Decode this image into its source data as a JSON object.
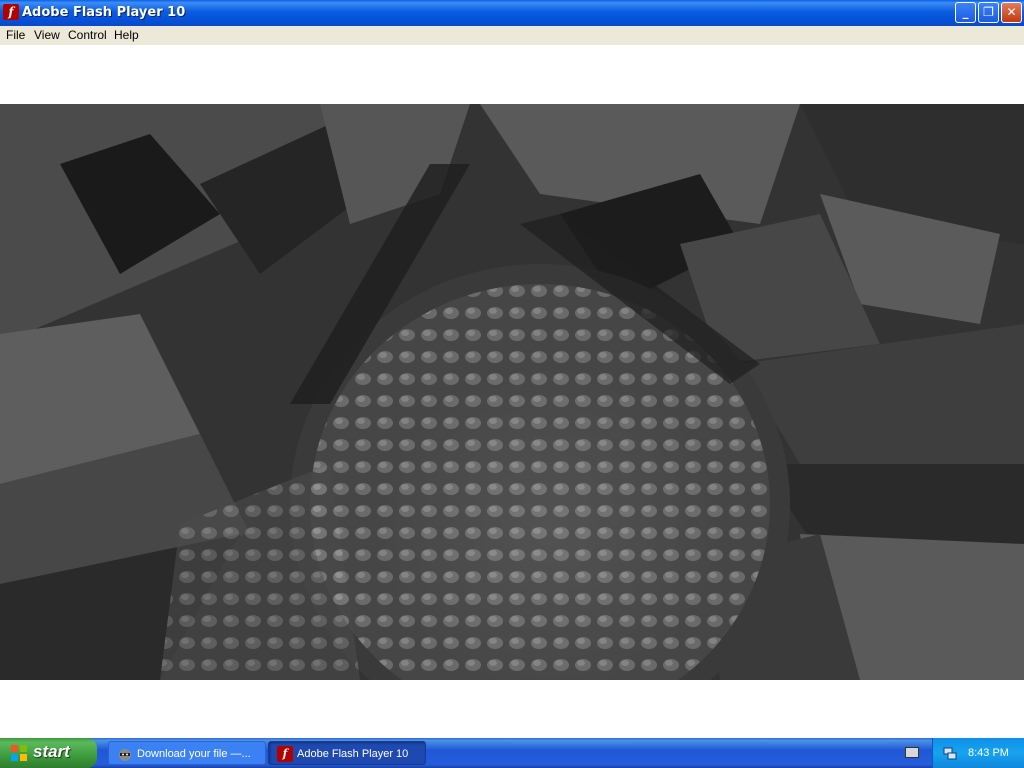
{
  "window": {
    "title": "Adobe Flash Player 10",
    "app_icon": "flash-icon",
    "controls": {
      "minimize": "minimize-icon",
      "maximize": "restore-icon",
      "close": "close-icon"
    }
  },
  "menubar": {
    "items": [
      "File",
      "View",
      "Control",
      "Help"
    ]
  },
  "stage": {
    "content": "flash-video-frame"
  },
  "taskbar": {
    "start_label": "start",
    "tasks": [
      {
        "label": "Download your file —...",
        "icon": "raccoon-icon",
        "active": false
      },
      {
        "label": "Adobe Flash Player 10",
        "icon": "flash-icon",
        "active": true
      }
    ],
    "tray": {
      "icons": [
        "keyboard-icon",
        "network-icon"
      ],
      "clock": "8:43 PM"
    }
  },
  "colors": {
    "titlebar": "#0550d8",
    "menubar": "#ece9d8",
    "taskbar": "#245edb",
    "start_button": "#3d9b3d",
    "tray": "#17a3f0",
    "close_button": "#c3380f"
  }
}
